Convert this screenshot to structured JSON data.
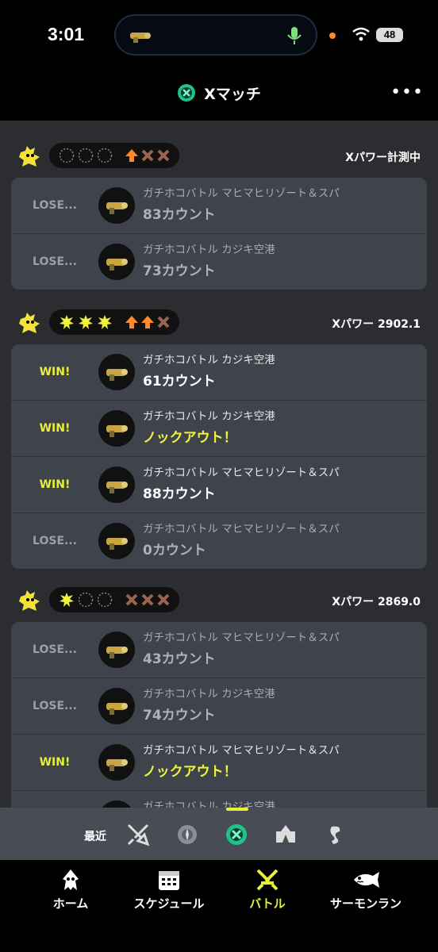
{
  "status_bar": {
    "time": "3:01",
    "battery": "48"
  },
  "header": {
    "title": "Xマッチ",
    "more_label": "•••"
  },
  "groups": [
    {
      "power": "Xパワー計測中",
      "wins_filled": 0,
      "arrows": [
        "up",
        "x",
        "x"
      ],
      "matches": [
        {
          "result": "LOSE...",
          "mode": "ガチホコバトル マヒマヒリゾート＆スパ",
          "count": "83カウント",
          "win": false,
          "ko": false
        },
        {
          "result": "LOSE...",
          "mode": "ガチホコバトル カジキ空港",
          "count": "73カウント",
          "win": false,
          "ko": false
        }
      ]
    },
    {
      "power": "Xパワー 2902.1",
      "wins_filled": 3,
      "arrows": [
        "up",
        "up",
        "x"
      ],
      "matches": [
        {
          "result": "WIN!",
          "mode": "ガチホコバトル カジキ空港",
          "count": "61カウント",
          "win": true,
          "ko": false
        },
        {
          "result": "WIN!",
          "mode": "ガチホコバトル カジキ空港",
          "count": "ノックアウト！",
          "win": true,
          "ko": true
        },
        {
          "result": "WIN!",
          "mode": "ガチホコバトル マヒマヒリゾート＆スパ",
          "count": "88カウント",
          "win": true,
          "ko": false
        },
        {
          "result": "LOSE...",
          "mode": "ガチホコバトル マヒマヒリゾート＆スパ",
          "count": "0カウント",
          "win": false,
          "ko": false
        }
      ]
    },
    {
      "power": "Xパワー 2869.0",
      "wins_filled": 1,
      "arrows": [
        "x",
        "x",
        "x"
      ],
      "matches": [
        {
          "result": "LOSE...",
          "mode": "ガチホコバトル マヒマヒリゾート＆スパ",
          "count": "43カウント",
          "win": false,
          "ko": false
        },
        {
          "result": "LOSE...",
          "mode": "ガチホコバトル カジキ空港",
          "count": "74カウント",
          "win": false,
          "ko": false
        },
        {
          "result": "WIN!",
          "mode": "ガチホコバトル マヒマヒリゾート＆スパ",
          "count": "ノックアウト！",
          "win": true,
          "ko": true
        },
        {
          "result": "",
          "mode": "ガチホコバトル カジキ空港",
          "count": "",
          "win": false,
          "ko": false
        }
      ]
    }
  ],
  "recent": {
    "label": "最近",
    "icons": [
      "battle-all-icon",
      "bankara-icon",
      "x-match-icon",
      "private-icon",
      "salmon-run-icon"
    ],
    "selected": "x-match-icon"
  },
  "tabs": [
    {
      "label": "ホーム",
      "icon": "squid-icon",
      "active": false
    },
    {
      "label": "スケジュール",
      "icon": "calendar-icon",
      "active": false
    },
    {
      "label": "バトル",
      "icon": "battle-icon",
      "active": true
    },
    {
      "label": "サーモンラン",
      "icon": "salmon-icon",
      "active": false
    }
  ],
  "colors": {
    "win": "#e8ef3a",
    "lose": "#9aa0a8",
    "card": "#3f444c",
    "accent_orange": "#ff8a2a",
    "x_green": "#1fc28a"
  }
}
